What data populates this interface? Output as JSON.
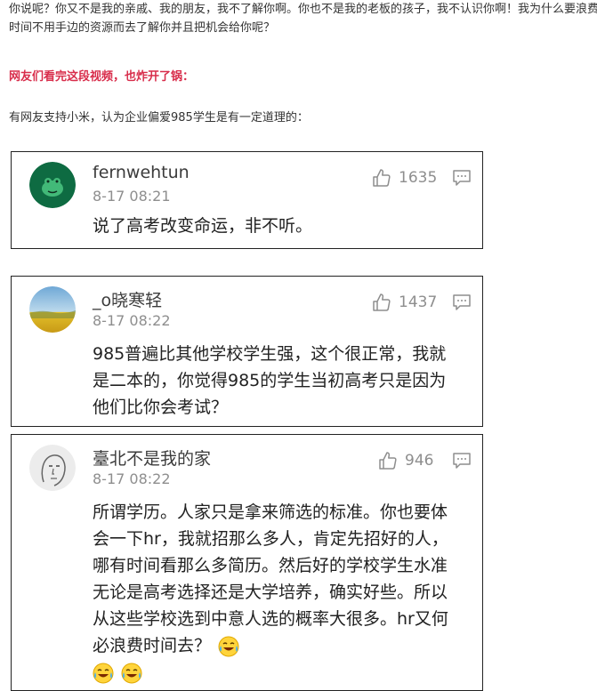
{
  "article": {
    "intro": "你说呢？你又不是我的亲戚、我的朋友，我不了解你啊。你也不是我的老板的孩子，我不认识你啊！我为什么要浪费时间不用手边的资源而去了解你并且把机会给你呢？",
    "headline": "网友们看完这段视频，也炸开了锅：",
    "support": "有网友支持小米，认为企业偏爱985学生是有一定道理的："
  },
  "comments": [
    {
      "username": "fernwehtun",
      "time": "8-17 08:21",
      "likes": "1635",
      "text": "说了高考改变命运，非不听。",
      "avatar": "green-frog-avatar"
    },
    {
      "username": "_o晓寒轻",
      "time": "8-17 08:22",
      "likes": "1437",
      "text": "985普遍比其他学校学生强，这个很正常，我就是二本的，你觉得985的学生当初高考只是因为他们比你会考试？",
      "avatar": "rapeseed-field-avatar"
    },
    {
      "username": "臺北不是我的家",
      "time": "8-17 08:22",
      "likes": "946",
      "text": "所谓学历。人家只是拿来筛选的标准。你也要体会一下hr，我就招那么多人，肯定先招好的人，哪有时间看那么多简历。然后好的学校学生水准无论是高考选择还是大学培养，确实好些。所以从这些学校选到中意人选的概率大很多。hr又何必浪费时间去？",
      "avatar": "sketch-face-avatar",
      "emojis": [
        "crying-laughing-emoji",
        "crying-laughing-emoji",
        "crying-laughing-emoji"
      ]
    }
  ],
  "colors": {
    "headline": "#d82d4b",
    "meta": "#8e8e8e",
    "border": "#222222"
  },
  "icons": [
    "thumbs-up-icon",
    "comment-icon"
  ]
}
